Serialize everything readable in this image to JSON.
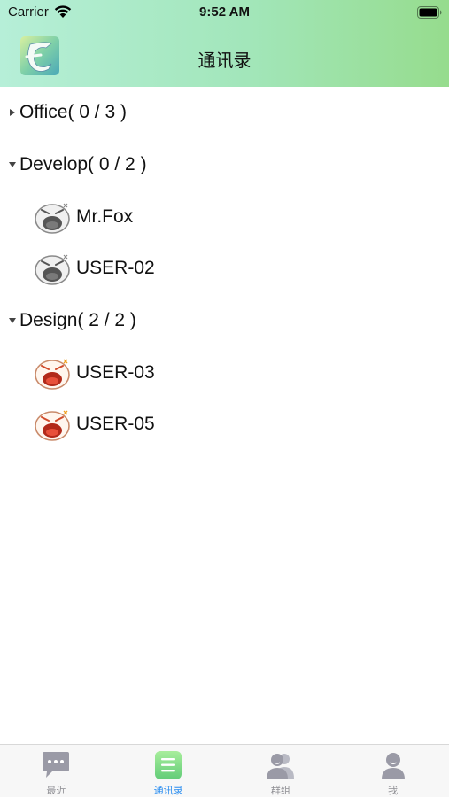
{
  "status_bar": {
    "carrier": "Carrier",
    "time": "9:52 AM"
  },
  "nav": {
    "title": "通讯录",
    "logo_icon": "app-logo-icon"
  },
  "groups": [
    {
      "label": "Office( 0 / 3 )",
      "expanded": false,
      "members": []
    },
    {
      "label": "Develop( 0 / 2 )",
      "expanded": true,
      "members": [
        {
          "name": "Mr.Fox",
          "online": false
        },
        {
          "name": "USER-02",
          "online": false
        }
      ]
    },
    {
      "label": "Design( 2 / 2 )",
      "expanded": true,
      "members": [
        {
          "name": "USER-03",
          "online": true
        },
        {
          "name": "USER-05",
          "online": true
        }
      ]
    }
  ],
  "tabs": [
    {
      "label": "最近",
      "icon": "chat-bubble-icon",
      "active": false
    },
    {
      "label": "通讯录",
      "icon": "contacts-list-icon",
      "active": true
    },
    {
      "label": "群组",
      "icon": "group-icon",
      "active": false
    },
    {
      "label": "我",
      "icon": "person-icon",
      "active": false
    }
  ],
  "colors": {
    "header_start": "#b6efd8",
    "header_end": "#96dc8d",
    "tab_active": "#2b8ef0",
    "tab_inactive": "#8e8e93"
  }
}
